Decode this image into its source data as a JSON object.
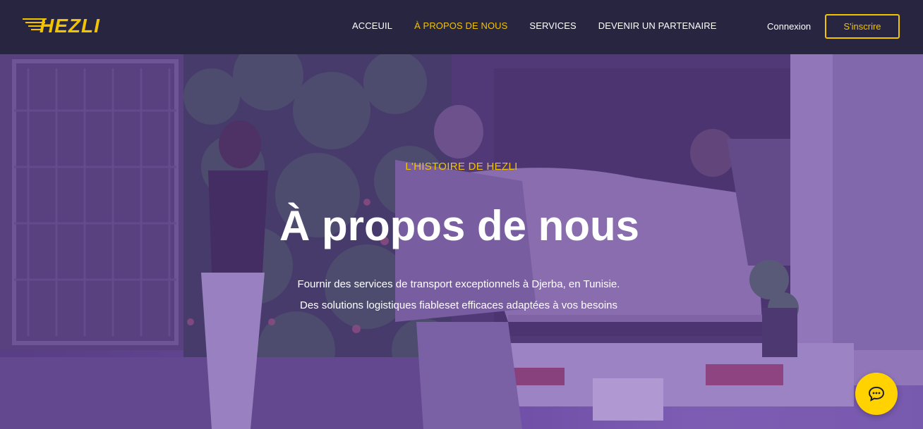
{
  "brand": {
    "logo_text": "HEZLI",
    "accent": "#f2c400"
  },
  "nav": {
    "items": [
      {
        "label": "ACCEUIL",
        "active": false
      },
      {
        "label": "À PROPOS DE NOUS",
        "active": true
      },
      {
        "label": "SERVICES",
        "active": false
      },
      {
        "label": "DEVENIR UN PARTENAIRE",
        "active": false
      }
    ],
    "login": "Connexion",
    "signup": "S'inscrire"
  },
  "hero": {
    "eyebrow": "L'HISTOIRE DE HEZLI",
    "title": "À propos de nous",
    "subtitle_line1": "Fournir des services de transport exceptionnels à Djerba, en Tunisie.",
    "subtitle_line2": "Des solutions logistiques fiableset efficaces adaptées à vos besoins"
  },
  "chat": {
    "icon": "chat-bubble-icon",
    "color": "#ffd200"
  }
}
